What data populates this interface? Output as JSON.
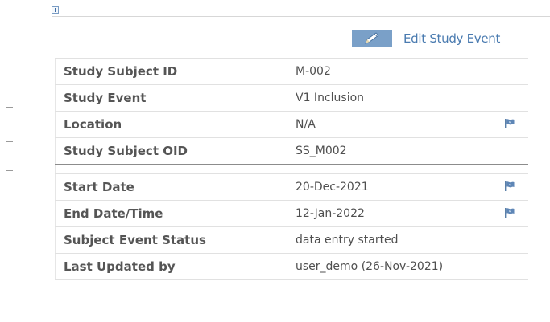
{
  "edit_link": {
    "label": "Edit Study Event"
  },
  "icons": {
    "expand": "plus-square-icon",
    "edit": "pencil-icon",
    "flag": "flag-icon"
  },
  "colors": {
    "label_text": "#555555",
    "value_text": "#4f4f4f",
    "link": "#4a7bb0",
    "edit_icon_bg": "#7aa0c8",
    "flag": "#5e86b6"
  },
  "subject_info": {
    "rows": [
      {
        "label": "Study Subject ID",
        "value": "M-002"
      },
      {
        "label": "Study Event",
        "value": "V1 Inclusion"
      },
      {
        "label": "Location",
        "value": "N/A"
      },
      {
        "label": "Study Subject OID",
        "value": "SS_M002"
      }
    ]
  },
  "event_info": {
    "rows": [
      {
        "label": "Start Date",
        "value": "20-Dec-2021"
      },
      {
        "label": "End Date/Time",
        "value": "12-Jan-2022"
      },
      {
        "label": "Subject Event Status",
        "value": "data entry started"
      },
      {
        "label": "Last Updated by",
        "value": "user_demo (26-Nov-2021)"
      }
    ]
  }
}
